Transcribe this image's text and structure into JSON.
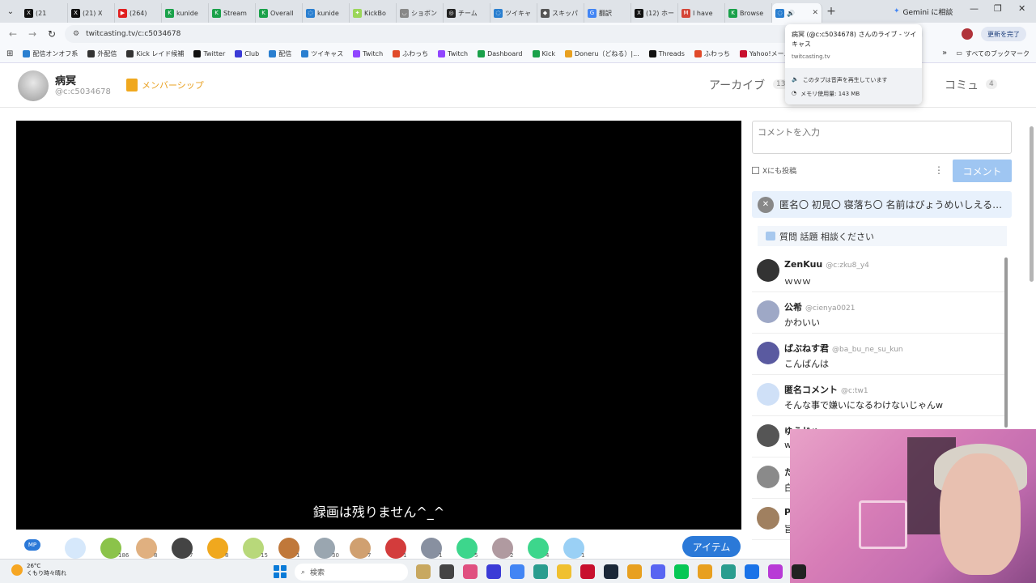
{
  "browser": {
    "tabs": [
      {
        "label": "(21",
        "color": "#111111",
        "glyph": "X"
      },
      {
        "label": "(21) X",
        "color": "#111111",
        "glyph": "X"
      },
      {
        "label": "(264)",
        "color": "#e02020",
        "glyph": "▶"
      },
      {
        "label": "kunide",
        "color": "#1aa14a",
        "glyph": "K"
      },
      {
        "label": "Stream",
        "color": "#1aa14a",
        "glyph": "K"
      },
      {
        "label": "Overall",
        "color": "#1aa14a",
        "glyph": "K"
      },
      {
        "label": "kunide",
        "color": "#2a7fd0",
        "glyph": "◌"
      },
      {
        "label": "KickBo",
        "color": "#9bd65a",
        "glyph": "✦"
      },
      {
        "label": "ショボン",
        "color": "#888888",
        "glyph": "◡"
      },
      {
        "label": "チーム",
        "color": "#222222",
        "glyph": "◎"
      },
      {
        "label": "ツイキャ",
        "color": "#2a7fd0",
        "glyph": "◌"
      },
      {
        "label": "スキッパ",
        "color": "#555555",
        "glyph": "◆"
      },
      {
        "label": "翻訳",
        "color": "#4285f4",
        "glyph": "G"
      },
      {
        "label": "(12) ホー",
        "color": "#111111",
        "glyph": "X"
      },
      {
        "label": "I have",
        "color": "#d44638",
        "glyph": "M"
      },
      {
        "label": "Browse",
        "color": "#1aa14a",
        "glyph": "K"
      }
    ],
    "active_tab": {
      "label": "",
      "color": "#2a7fd0",
      "glyph": "◌",
      "audio": "🔊",
      "close": "✕"
    },
    "new_tab": "+",
    "gemini_label": "Gemini に相談",
    "window_controls": {
      "minimize": "—",
      "restore": "❐",
      "close": "✕"
    },
    "url": "twitcasting.tv/c:c5034678",
    "update_label": "更新を完了",
    "nav": {
      "back": "←",
      "forward": "→",
      "reload": "↻",
      "site_info": "⚙"
    },
    "bookmarks": [
      {
        "label": "配信オンオフ系",
        "color": "#2a7fd0"
      },
      {
        "label": "外配信",
        "color": "#333333"
      },
      {
        "label": "Kick レイド候補",
        "color": "#333333"
      },
      {
        "label": "Twitter",
        "color": "#111111"
      },
      {
        "label": "Club",
        "color": "#3b3bd6"
      },
      {
        "label": "配信",
        "color": "#2a7fd0"
      },
      {
        "label": "ツイキャス",
        "color": "#2a7fd0"
      },
      {
        "label": "Twitch",
        "color": "#9146ff"
      },
      {
        "label": "ふわっち",
        "color": "#e04a2a"
      },
      {
        "label": "Twitch",
        "color": "#9146ff"
      },
      {
        "label": "Dashboard",
        "color": "#1aa14a"
      },
      {
        "label": "Kick",
        "color": "#1aa14a"
      },
      {
        "label": "Doneru（どねる）|...",
        "color": "#e8a020"
      },
      {
        "label": "Threads",
        "color": "#111111"
      },
      {
        "label": "ふわっち",
        "color": "#e04a2a"
      },
      {
        "label": "Yahoo!メール",
        "color": "#c8102e"
      }
    ],
    "bookmarks_overflow": "»",
    "all_bookmarks": "すべてのブックマーク"
  },
  "tab_popup": {
    "title": "病冥 (@c:c5034678) さんのライブ - ツイキャス",
    "domain": "twitcasting.tv",
    "audio_status": "このタブは音声を再生しています",
    "memory": "メモリ使用量: 143 MB"
  },
  "channel": {
    "name": "病冥",
    "id": "@c:c5034678",
    "membership": "メンバーシップ",
    "archive_label": "アーカイブ",
    "archive_count": "13",
    "community_label": "コミュ",
    "community_count": "4"
  },
  "player": {
    "subtitle": "録画は残りません^_^"
  },
  "items_bar": {
    "gifts": [
      {
        "color": "#d6e8fb",
        "count": ""
      },
      {
        "color": "#8bc34a",
        "count": "186"
      },
      {
        "color": "#e0b080",
        "count": "8"
      },
      {
        "color": "#444444",
        "count": "7"
      },
      {
        "color": "#f0a81e",
        "count": "8"
      },
      {
        "color": "#b8d87a",
        "count": "15"
      },
      {
        "color": "#c0783a",
        "count": "1"
      },
      {
        "color": "#9aa6b0",
        "count": "30"
      },
      {
        "color": "#d0a070",
        "count": "7"
      },
      {
        "color": "#d33c3c",
        "count": "1"
      },
      {
        "color": "#8890a0",
        "count": "1"
      },
      {
        "color": "#3dd68c",
        "count": "5"
      },
      {
        "color": "#b09aa0",
        "count": "2"
      },
      {
        "color": "#3dd68c",
        "count": "4"
      },
      {
        "color": "#9ad0f5",
        "count": "1"
      }
    ],
    "mp_label": "MP",
    "item_button": "アイテム"
  },
  "comment_form": {
    "placeholder": "コメントを入力",
    "x_post": "Xにも投稿",
    "menu": "⋮",
    "submit": "コメント"
  },
  "pinned": {
    "text": "匿名〇 初見〇 寝落ち〇 名前はびょうめいしえる…"
  },
  "topic": {
    "text": "質問 話題 相談ください"
  },
  "comments": [
    {
      "name": "ZenKuu",
      "uid": "@c:zku8_y4",
      "text": "ｗｗｗ",
      "avatar": "#333333"
    },
    {
      "name": "公希",
      "uid": "@cienya0021",
      "text": "かわいい",
      "avatar": "#9ea8c6"
    },
    {
      "name": "ばぶねす君",
      "uid": "@ba_bu_ne_su_kun",
      "text": "こんばんは",
      "avatar": "#5a5aa0"
    },
    {
      "name": "匿名コメント",
      "uid": "@c:tw1",
      "text": "そんな事で嫌いになるわけないじゃんw",
      "avatar": "#cfe0f7"
    },
    {
      "name": "ゆうじゅ",
      "uid": "",
      "text": "w",
      "avatar": "#555555"
    },
    {
      "name": "た",
      "uid": "",
      "text": "白",
      "avatar": "#8a8a8a"
    },
    {
      "name": "P",
      "uid": "",
      "text": "旨",
      "avatar": "#a08060"
    }
  ],
  "taskbar": {
    "temperature": "26°C",
    "weather": "くもり時々晴れ",
    "search_label": "検索",
    "icons": [
      "#c8a860",
      "#444444",
      "#e05080",
      "#3b3bd6",
      "#4285f4",
      "#2a9d8f",
      "#f0c030",
      "#c8102e",
      "#1b2838",
      "#e8a020",
      "#5865f2",
      "#06c755",
      "#e8a020",
      "#2a9d8f",
      "#1a73e8",
      "#b83ad6",
      "#222222"
    ]
  }
}
